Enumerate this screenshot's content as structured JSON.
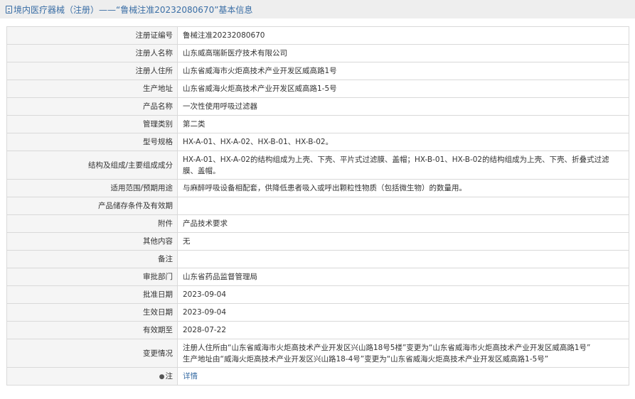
{
  "header": {
    "title": "境内医疗器械（注册）——“鲁械注准20232080670”基本信息"
  },
  "rows": [
    {
      "label": "注册证编号",
      "value": "鲁械注准20232080670"
    },
    {
      "label": "注册人名称",
      "value": "山东威高瑞新医疗技术有限公司"
    },
    {
      "label": "注册人住所",
      "value": "山东省威海市火炬高技术产业开发区威高路1号"
    },
    {
      "label": "生产地址",
      "value": "山东省威海火炬高技术产业开发区威高路1-5号"
    },
    {
      "label": "产品名称",
      "value": "一次性使用呼吸过滤器"
    },
    {
      "label": "管理类别",
      "value": "第二类"
    },
    {
      "label": "型号规格",
      "value": "HX-A-01、HX-A-02、HX-B-01、HX-B-02。"
    },
    {
      "label": "结构及组成/主要组成成分",
      "value": "HX-A-01、HX-A-02的结构组成为上壳、下壳、平片式过滤膜、盖帽；HX-B-01、HX-B-02的结构组成为上壳、下壳、折叠式过滤膜、盖帽。"
    },
    {
      "label": "适用范围/预期用途",
      "value": "与麻醉呼吸设备相配套，供降低患者吸入或呼出颗粒性物质（包括微生物）的数量用。"
    },
    {
      "label": "产品储存条件及有效期",
      "value": ""
    },
    {
      "label": "附件",
      "value": "产品技术要求"
    },
    {
      "label": "其他内容",
      "value": "无"
    },
    {
      "label": "备注",
      "value": ""
    },
    {
      "label": "审批部门",
      "value": "山东省药品监督管理局"
    },
    {
      "label": "批准日期",
      "value": "2023-09-04"
    },
    {
      "label": "生效日期",
      "value": "2023-09-04"
    },
    {
      "label": "有效期至",
      "value": "2028-07-22"
    },
    {
      "label": "变更情况",
      "value_line1": "注册人住所由“山东省威海市火炬高技术产业开发区兴山路18号5楼”变更为“山东省威海市火炬高技术产业开发区威高路1号”",
      "value_line2": "生产地址由“威海火炬高技术产业开发区兴山路18-4号”变更为“山东省威海火炬高技术产业开发区威高路1-5号”"
    },
    {
      "label": "注",
      "bullet": "●",
      "link": "详情"
    }
  ]
}
